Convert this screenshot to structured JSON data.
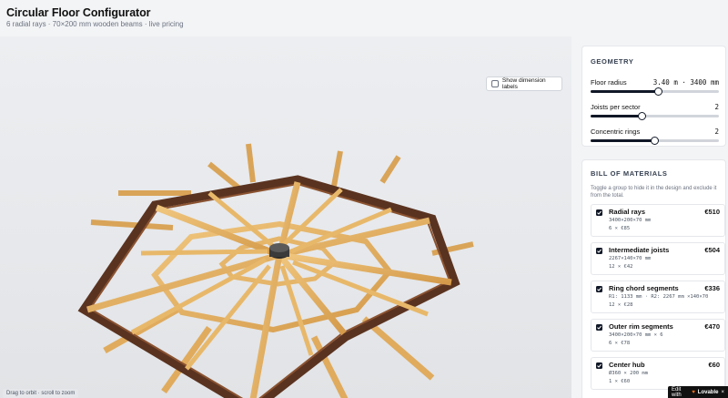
{
  "header": {
    "title": "Circular Floor Configurator",
    "subtitle": "6 radial rays · 70×200 mm wooden beams · live pricing"
  },
  "viewport": {
    "dimension_toggle_label": "Show dimension labels",
    "dimension_toggle_checked": false,
    "hint": "Drag to orbit · scroll to zoom"
  },
  "geometry": {
    "title": "GEOMETRY",
    "radius": {
      "label": "Floor radius",
      "value": "3.40 m · 3400 mm",
      "fraction": 0.53
    },
    "joists": {
      "label": "Joists per sector",
      "value": "2",
      "fraction": 0.4
    },
    "rings": {
      "label": "Concentric rings",
      "value": "2",
      "fraction": 0.5
    }
  },
  "bom": {
    "title": "BILL OF MATERIALS",
    "description": "Toggle a group to hide it in the design and exclude it from the total.",
    "items": [
      {
        "name": "Radial rays",
        "price": "€510",
        "spec": "3400×200×70 mm",
        "qty": "6 × €85"
      },
      {
        "name": "Intermediate joists",
        "price": "€504",
        "spec": "2267×140×70 mm",
        "qty": "12 × €42"
      },
      {
        "name": "Ring chord segments",
        "price": "€336",
        "spec": "R1: 1133 mm · R2: 2267 mm ×140×70",
        "qty": "12 × €28"
      },
      {
        "name": "Outer rim segments",
        "price": "€470",
        "spec": "3400×200×70 mm × 6",
        "qty": "6 × €78"
      },
      {
        "name": "Center hub",
        "price": "€60",
        "spec": "Ø360 × 200 mm",
        "qty": "1 × €60"
      }
    ]
  },
  "badge": {
    "prefix": "Edit with",
    "brand": "Lovable",
    "close": "×"
  },
  "colors": {
    "beam_light": "#e3b062",
    "beam_dark": "#5a3320",
    "accent": "#111827"
  }
}
